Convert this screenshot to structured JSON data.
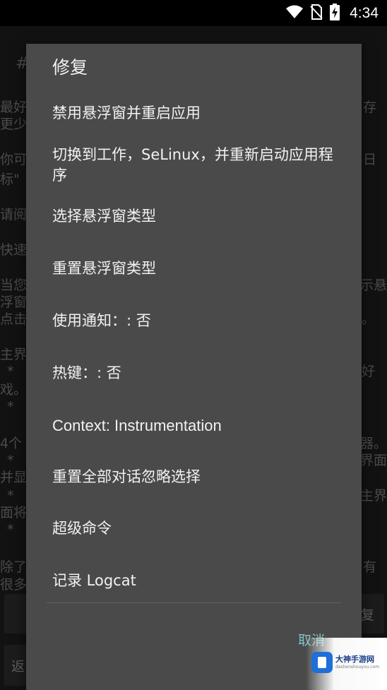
{
  "status_bar": {
    "time": "4:34",
    "icons": [
      "wifi-icon",
      "no-sim-icon",
      "battery-charging-icon"
    ]
  },
  "background": {
    "heading_fragment": "#",
    "left_fragments": [
      "最好",
      "更少",
      "你可",
      "标\"",
      "请阅",
      "快速",
      "当您",
      "浮窗",
      "点击",
      "主界",
      "  *",
      "戏。",
      "  *",
      "4个",
      "  *",
      "并显",
      "  *",
      "面将",
      "  *",
      "除了",
      "很多"
    ],
    "right_fragments": [
      "存",
      "日",
      "示悬",
      "。",
      "好",
      "器。",
      "界面",
      "主界",
      "有"
    ],
    "bottom_bar_label": "复",
    "back_button_label": "返"
  },
  "dialog": {
    "title": "修复",
    "items": [
      "禁用悬浮窗并重启应用",
      "切换到工作，SeLinux，并重新启动应用程序",
      "选择悬浮窗类型",
      "重置悬浮窗类型",
      "使用通知：: 否",
      "热键：: 否",
      "Context: Instrumentation",
      "重置全部对话忽略选择",
      "超级命令",
      "记录 Logcat"
    ],
    "cancel_label": "取消"
  },
  "watermark": {
    "name": "大神手游网",
    "url": "dashenshouyou.com"
  },
  "colors": {
    "dialog_bg": "#4a4a4a",
    "accent": "#7ec4c0",
    "status_bar": "#000000"
  }
}
